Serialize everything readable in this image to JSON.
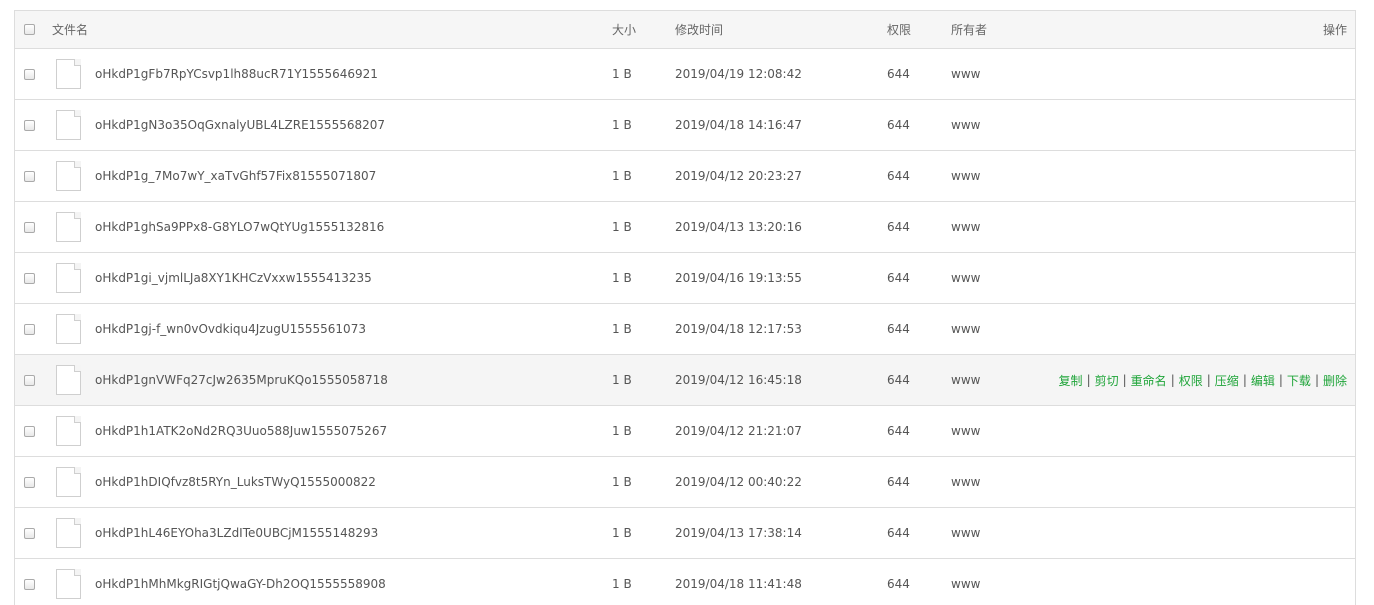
{
  "header": {
    "name": "文件名",
    "size": "大小",
    "mtime": "修改时间",
    "perm": "权限",
    "owner": "所有者",
    "ops": "操作"
  },
  "files": [
    {
      "name": "oHkdP1gFb7RpYCsvp1lh88ucR71Y1555646921",
      "size": "1 B",
      "mtime": "2019/04/19 12:08:42",
      "perm": "644",
      "owner": "www"
    },
    {
      "name": "oHkdP1gN3o35OqGxnalyUBL4LZRE1555568207",
      "size": "1 B",
      "mtime": "2019/04/18 14:16:47",
      "perm": "644",
      "owner": "www"
    },
    {
      "name": "oHkdP1g_7Mo7wY_xaTvGhf57Fix81555071807",
      "size": "1 B",
      "mtime": "2019/04/12 20:23:27",
      "perm": "644",
      "owner": "www"
    },
    {
      "name": "oHkdP1ghSa9PPx8-G8YLO7wQtYUg1555132816",
      "size": "1 B",
      "mtime": "2019/04/13 13:20:16",
      "perm": "644",
      "owner": "www"
    },
    {
      "name": "oHkdP1gi_vjmlLJa8XY1KHCzVxxw1555413235",
      "size": "1 B",
      "mtime": "2019/04/16 19:13:55",
      "perm": "644",
      "owner": "www"
    },
    {
      "name": "oHkdP1gj-f_wn0vOvdkiqu4JzugU1555561073",
      "size": "1 B",
      "mtime": "2019/04/18 12:17:53",
      "perm": "644",
      "owner": "www"
    },
    {
      "name": "oHkdP1gnVWFq27cJw2635MpruKQo1555058718",
      "size": "1 B",
      "mtime": "2019/04/12 16:45:18",
      "perm": "644",
      "owner": "www"
    },
    {
      "name": "oHkdP1h1ATK2oNd2RQ3Uuo588Juw1555075267",
      "size": "1 B",
      "mtime": "2019/04/12 21:21:07",
      "perm": "644",
      "owner": "www"
    },
    {
      "name": "oHkdP1hDIQfvz8t5RYn_LuksTWyQ1555000822",
      "size": "1 B",
      "mtime": "2019/04/12 00:40:22",
      "perm": "644",
      "owner": "www"
    },
    {
      "name": "oHkdP1hL46EYOha3LZdITe0UBCjM1555148293",
      "size": "1 B",
      "mtime": "2019/04/13 17:38:14",
      "perm": "644",
      "owner": "www"
    },
    {
      "name": "oHkdP1hMhMkgRIGtjQwaGY-Dh2OQ1555558908",
      "size": "1 B",
      "mtime": "2019/04/18 11:41:48",
      "perm": "644",
      "owner": "www"
    }
  ],
  "hover_row_index": 6,
  "actions": [
    "复制",
    "剪切",
    "重命名",
    "权限",
    "压缩",
    "编辑",
    "下载",
    "删除"
  ],
  "colors": {
    "action_link": "#20a53a",
    "header_bg": "#f6f6f6",
    "hover_bg": "#f5f5f5",
    "border": "#dddddd"
  }
}
